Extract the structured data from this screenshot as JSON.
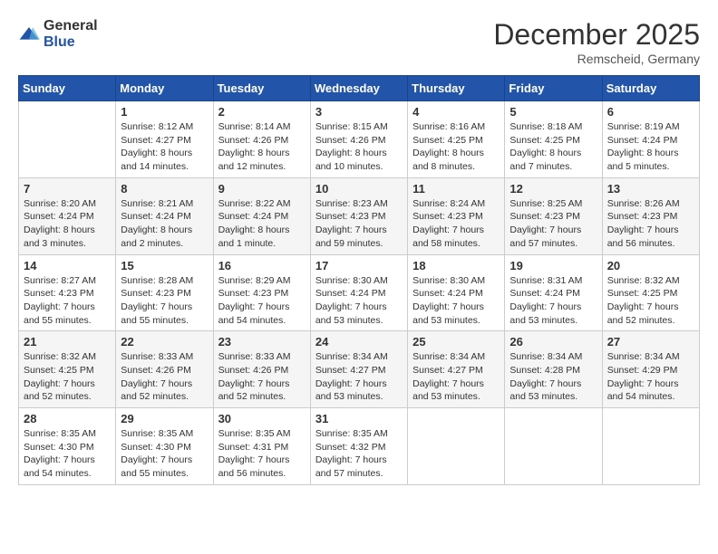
{
  "logo": {
    "general": "General",
    "blue": "Blue"
  },
  "title": {
    "month": "December 2025",
    "location": "Remscheid, Germany"
  },
  "weekdays": [
    "Sunday",
    "Monday",
    "Tuesday",
    "Wednesday",
    "Thursday",
    "Friday",
    "Saturday"
  ],
  "weeks": [
    [
      {
        "day": "",
        "info": ""
      },
      {
        "day": "1",
        "info": "Sunrise: 8:12 AM\nSunset: 4:27 PM\nDaylight: 8 hours\nand 14 minutes."
      },
      {
        "day": "2",
        "info": "Sunrise: 8:14 AM\nSunset: 4:26 PM\nDaylight: 8 hours\nand 12 minutes."
      },
      {
        "day": "3",
        "info": "Sunrise: 8:15 AM\nSunset: 4:26 PM\nDaylight: 8 hours\nand 10 minutes."
      },
      {
        "day": "4",
        "info": "Sunrise: 8:16 AM\nSunset: 4:25 PM\nDaylight: 8 hours\nand 8 minutes."
      },
      {
        "day": "5",
        "info": "Sunrise: 8:18 AM\nSunset: 4:25 PM\nDaylight: 8 hours\nand 7 minutes."
      },
      {
        "day": "6",
        "info": "Sunrise: 8:19 AM\nSunset: 4:24 PM\nDaylight: 8 hours\nand 5 minutes."
      }
    ],
    [
      {
        "day": "7",
        "info": "Sunrise: 8:20 AM\nSunset: 4:24 PM\nDaylight: 8 hours\nand 3 minutes."
      },
      {
        "day": "8",
        "info": "Sunrise: 8:21 AM\nSunset: 4:24 PM\nDaylight: 8 hours\nand 2 minutes."
      },
      {
        "day": "9",
        "info": "Sunrise: 8:22 AM\nSunset: 4:24 PM\nDaylight: 8 hours\nand 1 minute."
      },
      {
        "day": "10",
        "info": "Sunrise: 8:23 AM\nSunset: 4:23 PM\nDaylight: 7 hours\nand 59 minutes."
      },
      {
        "day": "11",
        "info": "Sunrise: 8:24 AM\nSunset: 4:23 PM\nDaylight: 7 hours\nand 58 minutes."
      },
      {
        "day": "12",
        "info": "Sunrise: 8:25 AM\nSunset: 4:23 PM\nDaylight: 7 hours\nand 57 minutes."
      },
      {
        "day": "13",
        "info": "Sunrise: 8:26 AM\nSunset: 4:23 PM\nDaylight: 7 hours\nand 56 minutes."
      }
    ],
    [
      {
        "day": "14",
        "info": "Sunrise: 8:27 AM\nSunset: 4:23 PM\nDaylight: 7 hours\nand 55 minutes."
      },
      {
        "day": "15",
        "info": "Sunrise: 8:28 AM\nSunset: 4:23 PM\nDaylight: 7 hours\nand 55 minutes."
      },
      {
        "day": "16",
        "info": "Sunrise: 8:29 AM\nSunset: 4:23 PM\nDaylight: 7 hours\nand 54 minutes."
      },
      {
        "day": "17",
        "info": "Sunrise: 8:30 AM\nSunset: 4:24 PM\nDaylight: 7 hours\nand 53 minutes."
      },
      {
        "day": "18",
        "info": "Sunrise: 8:30 AM\nSunset: 4:24 PM\nDaylight: 7 hours\nand 53 minutes."
      },
      {
        "day": "19",
        "info": "Sunrise: 8:31 AM\nSunset: 4:24 PM\nDaylight: 7 hours\nand 53 minutes."
      },
      {
        "day": "20",
        "info": "Sunrise: 8:32 AM\nSunset: 4:25 PM\nDaylight: 7 hours\nand 52 minutes."
      }
    ],
    [
      {
        "day": "21",
        "info": "Sunrise: 8:32 AM\nSunset: 4:25 PM\nDaylight: 7 hours\nand 52 minutes."
      },
      {
        "day": "22",
        "info": "Sunrise: 8:33 AM\nSunset: 4:26 PM\nDaylight: 7 hours\nand 52 minutes."
      },
      {
        "day": "23",
        "info": "Sunrise: 8:33 AM\nSunset: 4:26 PM\nDaylight: 7 hours\nand 52 minutes."
      },
      {
        "day": "24",
        "info": "Sunrise: 8:34 AM\nSunset: 4:27 PM\nDaylight: 7 hours\nand 53 minutes."
      },
      {
        "day": "25",
        "info": "Sunrise: 8:34 AM\nSunset: 4:27 PM\nDaylight: 7 hours\nand 53 minutes."
      },
      {
        "day": "26",
        "info": "Sunrise: 8:34 AM\nSunset: 4:28 PM\nDaylight: 7 hours\nand 53 minutes."
      },
      {
        "day": "27",
        "info": "Sunrise: 8:34 AM\nSunset: 4:29 PM\nDaylight: 7 hours\nand 54 minutes."
      }
    ],
    [
      {
        "day": "28",
        "info": "Sunrise: 8:35 AM\nSunset: 4:30 PM\nDaylight: 7 hours\nand 54 minutes."
      },
      {
        "day": "29",
        "info": "Sunrise: 8:35 AM\nSunset: 4:30 PM\nDaylight: 7 hours\nand 55 minutes."
      },
      {
        "day": "30",
        "info": "Sunrise: 8:35 AM\nSunset: 4:31 PM\nDaylight: 7 hours\nand 56 minutes."
      },
      {
        "day": "31",
        "info": "Sunrise: 8:35 AM\nSunset: 4:32 PM\nDaylight: 7 hours\nand 57 minutes."
      },
      {
        "day": "",
        "info": ""
      },
      {
        "day": "",
        "info": ""
      },
      {
        "day": "",
        "info": ""
      }
    ]
  ]
}
